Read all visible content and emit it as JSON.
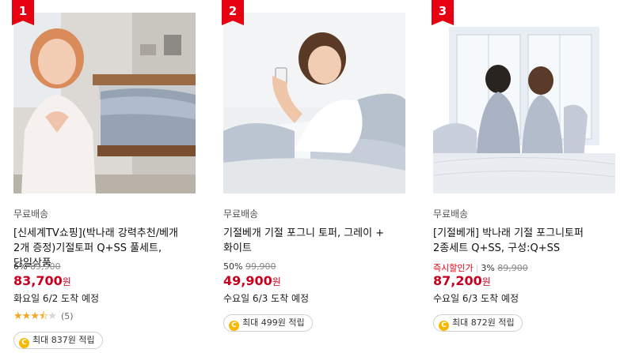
{
  "products": [
    {
      "rank": "1",
      "shipping": "무료배송",
      "title": "[신세계TV쇼핑](박나래 강력추천/베개 2개 증정)기절토퍼 Q+SS 풀세트, 단일상품",
      "discount": "6%",
      "original_price": "89,900",
      "sale_tag": "",
      "price": "83,700",
      "currency": "원",
      "delivery": "화요일 6/2 도착 예정",
      "rating": 3.5,
      "review_count": "(5)",
      "points": "최대 837원 적립",
      "image_icon": "product-photo-bedroom-heart"
    },
    {
      "rank": "2",
      "shipping": "무료배송",
      "title": "기절베개 기절 포그니 토퍼, 그레이 + 화이트",
      "discount": "50%",
      "original_price": "99,900",
      "sale_tag": "",
      "price": "49,900",
      "currency": "원",
      "delivery": "수요일 6/3 도착 예정",
      "points": "최대 499원 적립",
      "image_icon": "product-photo-woman-phone"
    },
    {
      "rank": "3",
      "shipping": "무료배송",
      "title": "[기절베개] 박나래 기절 포그니토퍼 2종세트 Q+SS, 구성:Q+SS",
      "discount": "3%",
      "original_price": "89,900",
      "sale_tag": "즉시할인가",
      "price": "87,200",
      "currency": "원",
      "delivery": "수요일 6/3 도착 예정",
      "points": "최대 872원 적립",
      "image_icon": "product-photo-couple-window"
    }
  ],
  "colors": {
    "rank_badge": "#e60012",
    "price": "#c8001f",
    "star": "#f5a623",
    "coin": "#f6b800"
  }
}
